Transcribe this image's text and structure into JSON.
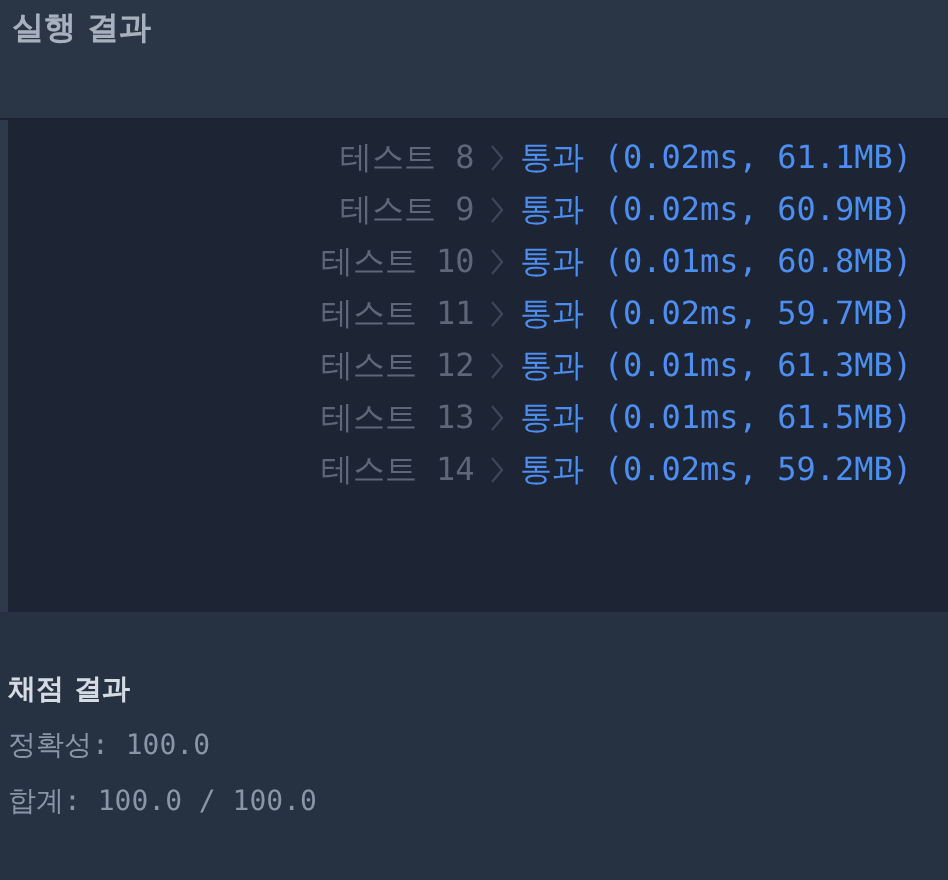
{
  "run_results": {
    "title": "실행 결과",
    "tests": [
      {
        "label": "테스트 8",
        "kind": "pass",
        "result": "통과 (0.02ms, 61.1MB)"
      },
      {
        "label": "테스트 9",
        "kind": "pass",
        "result": "통과 (0.02ms, 60.9MB)"
      },
      {
        "label": "테스트 10",
        "kind": "pass",
        "result": "통과 (0.01ms, 60.8MB)"
      },
      {
        "label": "테스트 11",
        "kind": "pass",
        "result": "통과 (0.02ms, 59.7MB)"
      },
      {
        "label": "테스트 12",
        "kind": "pass",
        "result": "통과 (0.01ms, 61.3MB)"
      },
      {
        "label": "테스트 13",
        "kind": "pass",
        "result": "통과 (0.01ms, 61.5MB)"
      },
      {
        "label": "테스트 14",
        "kind": "pass",
        "result": "통과 (0.02ms, 59.2MB)"
      }
    ]
  },
  "grading": {
    "title": "채점 결과",
    "accuracy": "정확성: 100.0",
    "total": "합계: 100.0 / 100.0"
  }
}
